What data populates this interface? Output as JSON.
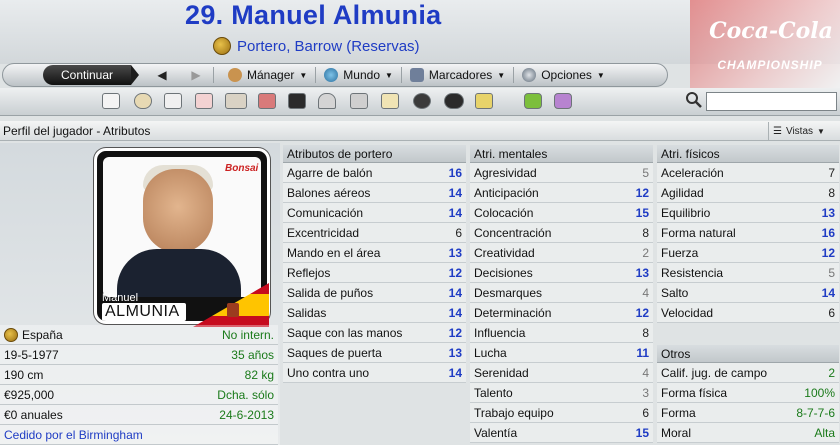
{
  "header": {
    "title": "29. Manuel Almunia",
    "subtitle": "Portero, Barrow (Reservas)",
    "sponsor_line1": "Coca-Cola",
    "sponsor_line2": "CHAMPIONSHIP"
  },
  "menu": {
    "continue": "Continuar",
    "manager": "Mánager",
    "world": "Mundo",
    "bookmarks": "Marcadores",
    "options": "Opciones"
  },
  "search": {
    "value": ""
  },
  "page": {
    "heading": "Perfil del jugador - Atributos",
    "views": "Vistas"
  },
  "card": {
    "logo": "Bonsai",
    "first_name": "Manuel",
    "last_name": "ALMUNIA"
  },
  "info": [
    {
      "label": "España",
      "value": "No intern."
    },
    {
      "label": "19-5-1977",
      "value": "35 años"
    },
    {
      "label": "190 cm",
      "value": "82 kg"
    },
    {
      "label": "€925,000",
      "value": "Dcha. sólo"
    },
    {
      "label": "€0 anuales",
      "value": "24-6-2013"
    },
    {
      "label": "Cedido por el Birmingham",
      "value": ""
    }
  ],
  "goalkeeping": {
    "title": "Atributos de portero",
    "rows": [
      {
        "label": "Agarre de balón",
        "value": "16"
      },
      {
        "label": "Balones aéreos",
        "value": "14"
      },
      {
        "label": "Comunicación",
        "value": "14"
      },
      {
        "label": "Excentricidad",
        "value": "6"
      },
      {
        "label": "Mando en el área",
        "value": "13"
      },
      {
        "label": "Reflejos",
        "value": "12"
      },
      {
        "label": "Salida de puños",
        "value": "14"
      },
      {
        "label": "Salidas",
        "value": "14"
      },
      {
        "label": "Saque con las manos",
        "value": "12"
      },
      {
        "label": "Saques de puerta",
        "value": "13"
      },
      {
        "label": "Uno contra uno",
        "value": "14"
      }
    ]
  },
  "mental": {
    "title": "Atri. mentales",
    "rows": [
      {
        "label": "Agresividad",
        "value": "5"
      },
      {
        "label": "Anticipación",
        "value": "12"
      },
      {
        "label": "Colocación",
        "value": "15"
      },
      {
        "label": "Concentración",
        "value": "8"
      },
      {
        "label": "Creatividad",
        "value": "2"
      },
      {
        "label": "Decisiones",
        "value": "13"
      },
      {
        "label": "Desmarques",
        "value": "4"
      },
      {
        "label": "Determinación",
        "value": "12"
      },
      {
        "label": "Influencia",
        "value": "8"
      },
      {
        "label": "Lucha",
        "value": "11"
      },
      {
        "label": "Serenidad",
        "value": "4"
      },
      {
        "label": "Talento",
        "value": "3"
      },
      {
        "label": "Trabajo equipo",
        "value": "6"
      },
      {
        "label": "Valentía",
        "value": "15"
      }
    ]
  },
  "physical": {
    "title": "Atri. físicos",
    "rows": [
      {
        "label": "Aceleración",
        "value": "7"
      },
      {
        "label": "Agilidad",
        "value": "8"
      },
      {
        "label": "Equilibrio",
        "value": "13"
      },
      {
        "label": "Forma natural",
        "value": "16"
      },
      {
        "label": "Fuerza",
        "value": "12"
      },
      {
        "label": "Resistencia",
        "value": "5"
      },
      {
        "label": "Salto",
        "value": "14"
      },
      {
        "label": "Velocidad",
        "value": "6"
      }
    ]
  },
  "other": {
    "title": "Otros",
    "rows": [
      {
        "label": "Calif. jug. de campo",
        "value": "2"
      },
      {
        "label": "Forma física",
        "value": "100%"
      },
      {
        "label": "Forma",
        "value": "8-7-7-6"
      },
      {
        "label": "Moral",
        "value": "Alta"
      }
    ]
  },
  "colors": {
    "accent": "#1f3cc4",
    "good": "#1a7a1a"
  }
}
